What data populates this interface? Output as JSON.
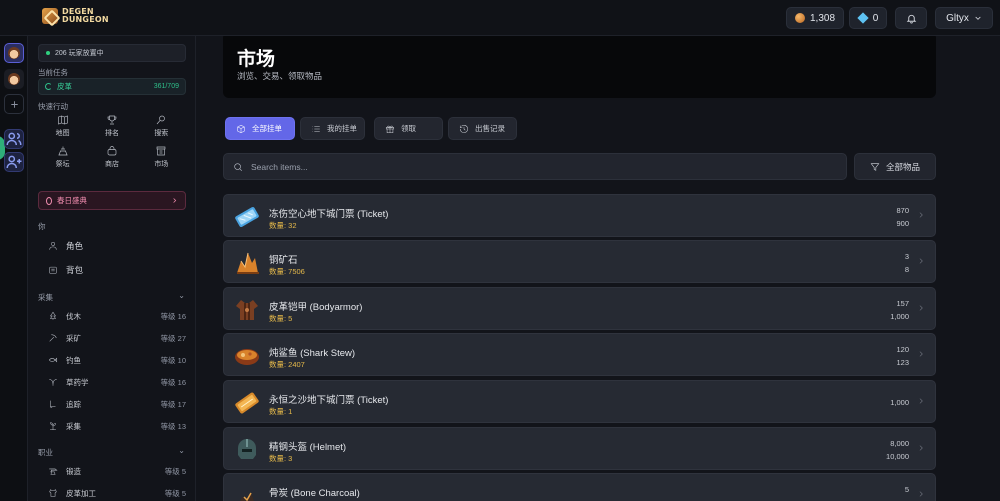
{
  "app": {
    "logo_line1": "DEGEN",
    "logo_line2": "DUNGEON",
    "coins": "1,308",
    "gems": "0",
    "username": "Gltyx"
  },
  "sidebar": {
    "online": "206 玩家放置中",
    "current_task_label": "当前任务",
    "current_task": {
      "name": "皮革",
      "progress": "361/709"
    },
    "quick_label": "快速行动",
    "quick": [
      {
        "label": "地图",
        "icon": "map-icon"
      },
      {
        "label": "排名",
        "icon": "trophy-icon"
      },
      {
        "label": "搜索",
        "icon": "search-icon"
      },
      {
        "label": "祭坛",
        "icon": "altar-icon"
      },
      {
        "label": "商店",
        "icon": "shop-icon"
      },
      {
        "label": "市场",
        "icon": "market-icon"
      }
    ],
    "festival": "春日盛典",
    "you_label": "你",
    "character": "角色",
    "bag": "背包",
    "gathering_label": "采集",
    "gathering": [
      {
        "label": "伐木",
        "level": "等级 16"
      },
      {
        "label": "采矿",
        "level": "等级 27"
      },
      {
        "label": "钓鱼",
        "level": "等级 10"
      },
      {
        "label": "草药学",
        "level": "等级 16"
      },
      {
        "label": "追踪",
        "level": "等级 17"
      },
      {
        "label": "采集",
        "level": "等级 13"
      }
    ],
    "profession_label": "职业",
    "professions": [
      {
        "label": "锻造",
        "level": "等级 5"
      },
      {
        "label": "皮革加工",
        "level": "等级 5"
      }
    ]
  },
  "main": {
    "title": "市场",
    "subtitle": "浏览、交易、领取物品",
    "tabs": [
      "全部挂单",
      "我的挂单",
      "领取",
      "出售记录"
    ],
    "search_placeholder": "Search items...",
    "filter_label": "全部物品",
    "items": [
      {
        "name": "冻伤空心地下城门票 (Ticket)",
        "qty": "数量: 32",
        "price1": "870",
        "price2": "900"
      },
      {
        "name": "铜矿石",
        "qty": "数量: 7506",
        "price1": "3",
        "price2": "8"
      },
      {
        "name": "皮革铠甲 (Bodyarmor)",
        "qty": "数量: 5",
        "price1": "157",
        "price2": "1,000"
      },
      {
        "name": "炖鲨鱼 (Shark Stew)",
        "qty": "数量: 2407",
        "price1": "120",
        "price2": "123"
      },
      {
        "name": "永恒之沙地下城门票 (Ticket)",
        "qty": "数量: 1",
        "price1": "1,000",
        "price2": ""
      },
      {
        "name": "精钢头盔 (Helmet)",
        "qty": "数量: 3",
        "price1": "8,000",
        "price2": "10,000"
      },
      {
        "name": "骨炭 (Bone Charcoal)",
        "qty": "",
        "price1": "5",
        "price2": ""
      }
    ]
  },
  "colors": {
    "accent": "#6367e8",
    "quantity": "#e5b94a",
    "online": "#2fd07e",
    "task": "#38d09a",
    "festival": "#f08cae"
  }
}
